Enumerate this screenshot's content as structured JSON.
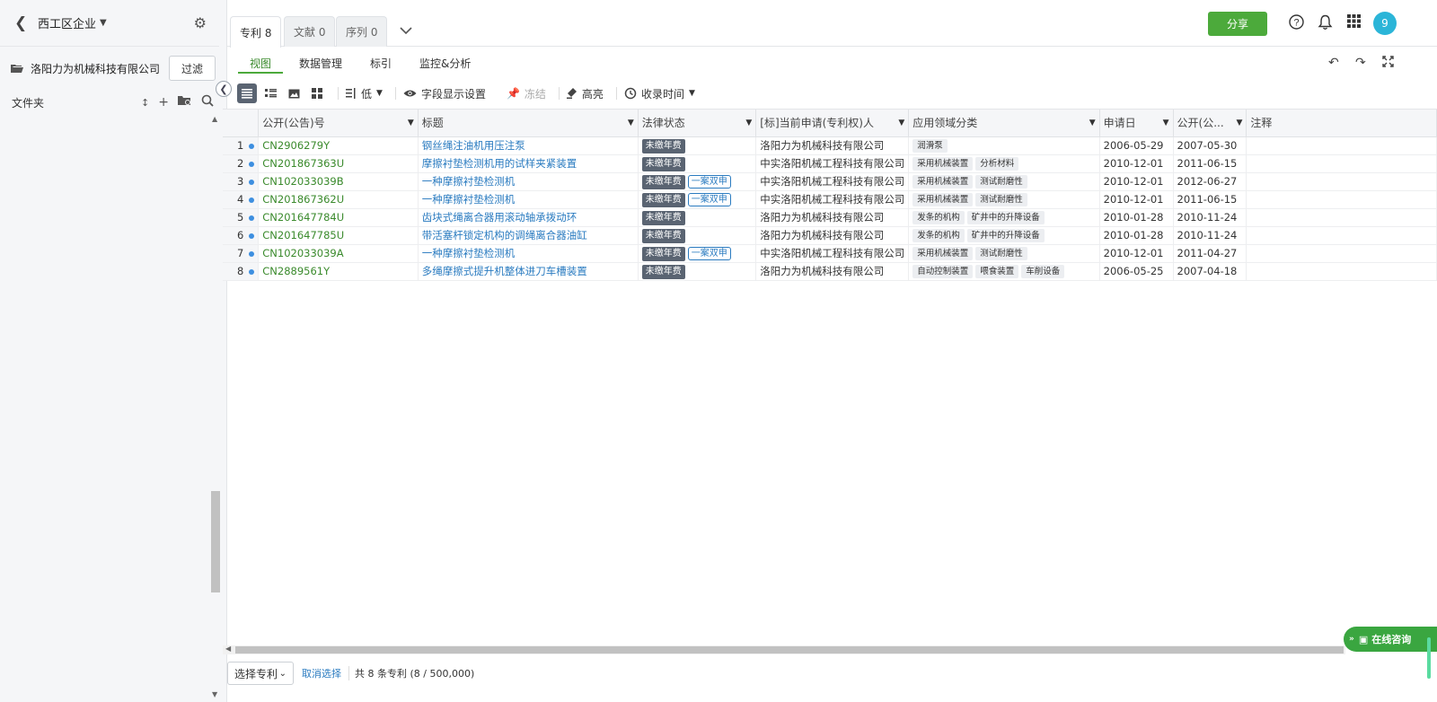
{
  "sidebar": {
    "title": "西工区企业",
    "company": "洛阳力为机械科技有限公司",
    "filter_label": "过滤",
    "folders_label": "文件夹"
  },
  "tabs": [
    {
      "label": "专利 8"
    },
    {
      "label": "文献 0"
    },
    {
      "label": "序列 0"
    }
  ],
  "header": {
    "share_label": "分享",
    "avatar_text": "9"
  },
  "subtabs": [
    {
      "label": "视图"
    },
    {
      "label": "数据管理"
    },
    {
      "label": "标引"
    },
    {
      "label": "监控&分析"
    }
  ],
  "toolbar": {
    "density": "低",
    "fields": "字段显示设置",
    "freeze": "冻结",
    "highlight": "高亮",
    "sort": "收录时间"
  },
  "table": {
    "columns": [
      "公开(公告)号",
      "标题",
      "法律状态",
      "[标]当前申请(专利权)人",
      "应用领域分类",
      "申请日",
      "公开(公...",
      "注释"
    ],
    "rows": [
      {
        "n": "1",
        "pn": "CN2906279Y",
        "title": "钢丝绳注油机用压注泵",
        "status": "未缴年费",
        "extra": "",
        "applicant": "洛阳力为机械科技有限公司",
        "tags": [
          "润滑泵"
        ],
        "apd": "2006-05-29",
        "pd": "2007-05-30"
      },
      {
        "n": "2",
        "pn": "CN201867363U",
        "title": "摩擦衬垫检测机用的试样夹紧装置",
        "status": "未缴年费",
        "extra": "",
        "applicant": "中实洛阳机械工程科技有限公司",
        "tags": [
          "采用机械装置",
          "分析材料"
        ],
        "apd": "2010-12-01",
        "pd": "2011-06-15"
      },
      {
        "n": "3",
        "pn": "CN102033039B",
        "title": "一种摩擦衬垫检测机",
        "status": "未缴年费",
        "extra": "一案双申",
        "applicant": "中实洛阳机械工程科技有限公司",
        "tags": [
          "采用机械装置",
          "测试耐磨性"
        ],
        "apd": "2010-12-01",
        "pd": "2012-06-27"
      },
      {
        "n": "4",
        "pn": "CN201867362U",
        "title": "一种摩擦衬垫检测机",
        "status": "未缴年费",
        "extra": "一案双申",
        "applicant": "中实洛阳机械工程科技有限公司",
        "tags": [
          "采用机械装置",
          "测试耐磨性"
        ],
        "apd": "2010-12-01",
        "pd": "2011-06-15"
      },
      {
        "n": "5",
        "pn": "CN201647784U",
        "title": "齿块式绳离合器用滚动轴承拨动环",
        "status": "未缴年费",
        "extra": "",
        "applicant": "洛阳力为机械科技有限公司",
        "tags": [
          "发条的机构",
          "矿井中的升降设备"
        ],
        "apd": "2010-01-28",
        "pd": "2010-11-24"
      },
      {
        "n": "6",
        "pn": "CN201647785U",
        "title": "带活塞杆锁定机构的调绳离合器油缸",
        "status": "未缴年费",
        "extra": "",
        "applicant": "洛阳力为机械科技有限公司",
        "tags": [
          "发条的机构",
          "矿井中的升降设备"
        ],
        "apd": "2010-01-28",
        "pd": "2010-11-24"
      },
      {
        "n": "7",
        "pn": "CN102033039A",
        "title": "一种摩擦衬垫检测机",
        "status": "未缴年费",
        "extra": "一案双申",
        "applicant": "中实洛阳机械工程科技有限公司",
        "tags": [
          "采用机械装置",
          "测试耐磨性"
        ],
        "apd": "2010-12-01",
        "pd": "2011-04-27"
      },
      {
        "n": "8",
        "pn": "CN2889561Y",
        "title": "多绳摩擦式提升机整体进刀车槽装置",
        "status": "未缴年费",
        "extra": "",
        "applicant": "洛阳力为机械科技有限公司",
        "tags": [
          "自动控制装置",
          "喂食装置",
          "车削设备"
        ],
        "apd": "2006-05-25",
        "pd": "2007-04-18"
      }
    ]
  },
  "footer": {
    "select_label": "选择专利",
    "cancel_label": "取消选择",
    "count_text": "共 8 条专利 (8 / 500,000)"
  },
  "chat": {
    "label": "在线咨询"
  },
  "colors": {
    "accent": "#4caa3b",
    "link": "#2a7bc0",
    "badge": "#5a6472"
  }
}
